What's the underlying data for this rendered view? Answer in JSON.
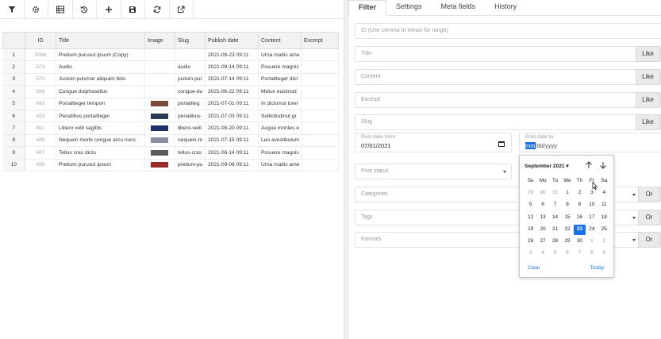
{
  "toolbar": {
    "buttons": [
      {
        "icon": "filter-icon"
      },
      {
        "icon": "gear-icon"
      },
      {
        "icon": "columns-icon"
      },
      {
        "icon": "history-icon"
      },
      {
        "icon": "plus-icon"
      },
      {
        "icon": "save-icon"
      },
      {
        "icon": "refresh-icon"
      },
      {
        "icon": "external-link-icon"
      }
    ]
  },
  "table": {
    "columns": [
      "",
      "ID",
      "Title",
      "Image",
      "Slug",
      "Publish date",
      "Content",
      "Excerpt"
    ],
    "rows": [
      {
        "n": "1",
        "id": "3096",
        "title": "Pretium purusut ipsum (Copy)",
        "img": "",
        "slug": "",
        "date": "2021-09-23 09:11",
        "content": "Urna mattis ame",
        "excerpt": ""
      },
      {
        "n": "2",
        "id": "573",
        "title": "Audio",
        "img": "",
        "slug": "audio",
        "date": "2021-09-14 09:11",
        "content": "Posuere magnis",
        "excerpt": ""
      },
      {
        "n": "3",
        "id": "570",
        "title": "Justoin pulvinar aliquam felis",
        "img": "",
        "slug": "justoin-pul",
        "date": "2021-07-14 09:11",
        "content": "Portaitteger dict",
        "excerpt": ""
      },
      {
        "n": "4",
        "id": "566",
        "title": "Congue duiphasellus",
        "img": "",
        "slug": "congue-du",
        "date": "2021-06-22 09:11",
        "content": "Metus euismod",
        "excerpt": ""
      },
      {
        "n": "5",
        "id": "493",
        "title": "Portaitteger tempori",
        "img": "#7a4a38",
        "slug": "portaitteg",
        "date": "2021-07-01 09:11",
        "content": "In dictumst lorer",
        "excerpt": ""
      },
      {
        "n": "6",
        "id": "493",
        "title": "Penatibus portaitteger",
        "img": "#2b3a55",
        "slug": "penatibus-",
        "date": "2021-07-03 09:11",
        "content": "Sollicitudinut  gr",
        "excerpt": ""
      },
      {
        "n": "7",
        "id": "491",
        "title": "Libero velit sagittis",
        "img": "#1e2f6a",
        "slug": "libero-velit",
        "date": "2021-08-20 09:11",
        "content": "Augue montes e",
        "excerpt": ""
      },
      {
        "n": "8",
        "id": "489",
        "title": "Nequein morbi congue arcu nunc",
        "img": "#8a8fa0",
        "slug": "nequein-m",
        "date": "2021-07-15 09:11",
        "content": "Leo avestibulum",
        "excerpt": ""
      },
      {
        "n": "9",
        "id": "487",
        "title": "Tellus cras dictu",
        "img": "#5a5a5a",
        "slug": "tellus-cras",
        "date": "2021-06-14 09:11",
        "content": "Posuere magnis",
        "excerpt": ""
      },
      {
        "n": "10",
        "id": "485",
        "title": "Pretium purusut ipsum",
        "img": "#9b2a2a",
        "slug": "pretium-pu",
        "date": "2021-09-06 09:11",
        "content": "Urna mattis ame",
        "excerpt": ""
      }
    ]
  },
  "tabs": [
    {
      "label": "Filter",
      "active": true
    },
    {
      "label": "Settings",
      "active": false
    },
    {
      "label": "Meta fields",
      "active": false
    },
    {
      "label": "History",
      "active": false
    }
  ],
  "filter": {
    "id_placeholder": "ID (Use comma or minus for range)",
    "title_placeholder": "Title",
    "content_placeholder": "Content",
    "excerpt_placeholder": "Excerpt",
    "slug_placeholder": "Slug",
    "like_label": "Like",
    "or_label": "Or",
    "date_from_label": "Post date from",
    "date_from_value": "07/01/2021",
    "date_to_label": "Post date to",
    "date_to_value_mm": "mm",
    "date_to_value_rest": "/dd/yyyy",
    "status_placeholder": "Post status",
    "categories_placeholder": "Categories",
    "tags_placeholder": "Tags",
    "formats_placeholder": "Formats"
  },
  "calendar": {
    "month_label": "September 2021 ▾",
    "weekdays": [
      "Su",
      "Mo",
      "Tu",
      "We",
      "Th",
      "Fr",
      "Sa"
    ],
    "days": [
      {
        "d": "29",
        "m": true
      },
      {
        "d": "30",
        "m": true
      },
      {
        "d": "31",
        "m": true
      },
      {
        "d": "1"
      },
      {
        "d": "2"
      },
      {
        "d": "3"
      },
      {
        "d": "4"
      },
      {
        "d": "5"
      },
      {
        "d": "6"
      },
      {
        "d": "7"
      },
      {
        "d": "8"
      },
      {
        "d": "9"
      },
      {
        "d": "10"
      },
      {
        "d": "11"
      },
      {
        "d": "12"
      },
      {
        "d": "13"
      },
      {
        "d": "14"
      },
      {
        "d": "15"
      },
      {
        "d": "16"
      },
      {
        "d": "17"
      },
      {
        "d": "18"
      },
      {
        "d": "19"
      },
      {
        "d": "20"
      },
      {
        "d": "21"
      },
      {
        "d": "22"
      },
      {
        "d": "23",
        "sel": true
      },
      {
        "d": "24"
      },
      {
        "d": "25"
      },
      {
        "d": "26"
      },
      {
        "d": "27"
      },
      {
        "d": "28"
      },
      {
        "d": "29"
      },
      {
        "d": "30"
      },
      {
        "d": "1",
        "m": true
      },
      {
        "d": "2",
        "m": true
      },
      {
        "d": "3",
        "m": true
      },
      {
        "d": "4",
        "m": true
      },
      {
        "d": "5",
        "m": true
      },
      {
        "d": "6",
        "m": true
      },
      {
        "d": "7",
        "m": true
      },
      {
        "d": "8",
        "m": true
      },
      {
        "d": "9",
        "m": true
      }
    ],
    "clear_label": "Clear",
    "today_label": "Today",
    "accent": "#1a73e8"
  }
}
